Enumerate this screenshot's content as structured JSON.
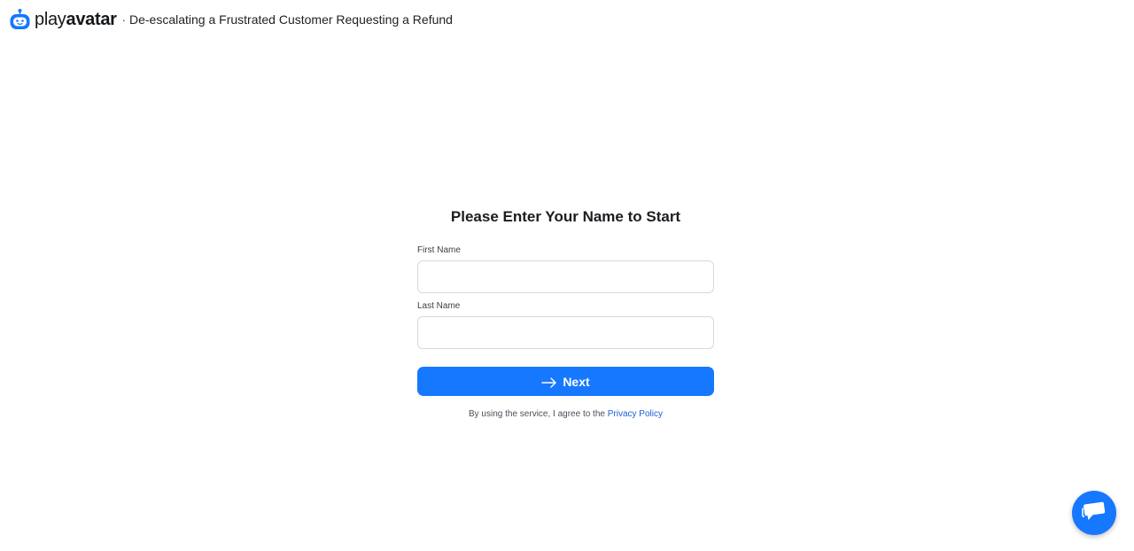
{
  "header": {
    "brand_light": "play",
    "brand_bold": "avatar",
    "separator": "·",
    "subtitle": "De-escalating a Frustrated Customer Requesting a Refund"
  },
  "form": {
    "title": "Please Enter Your Name to Start",
    "first_name_label": "First Name",
    "first_name_value": "",
    "last_name_label": "Last Name",
    "last_name_value": "",
    "next_label": "Next",
    "terms_text": "By using the service, I agree to the",
    "privacy_link": "Privacy Policy"
  },
  "icons": {
    "logo": "robot-face-icon",
    "next": "arrow-right-icon",
    "chat": "chat-bubble-icon"
  },
  "colors": {
    "accent": "#1677ff",
    "link": "#1a5fd1",
    "input_border": "#d6d8dc"
  }
}
